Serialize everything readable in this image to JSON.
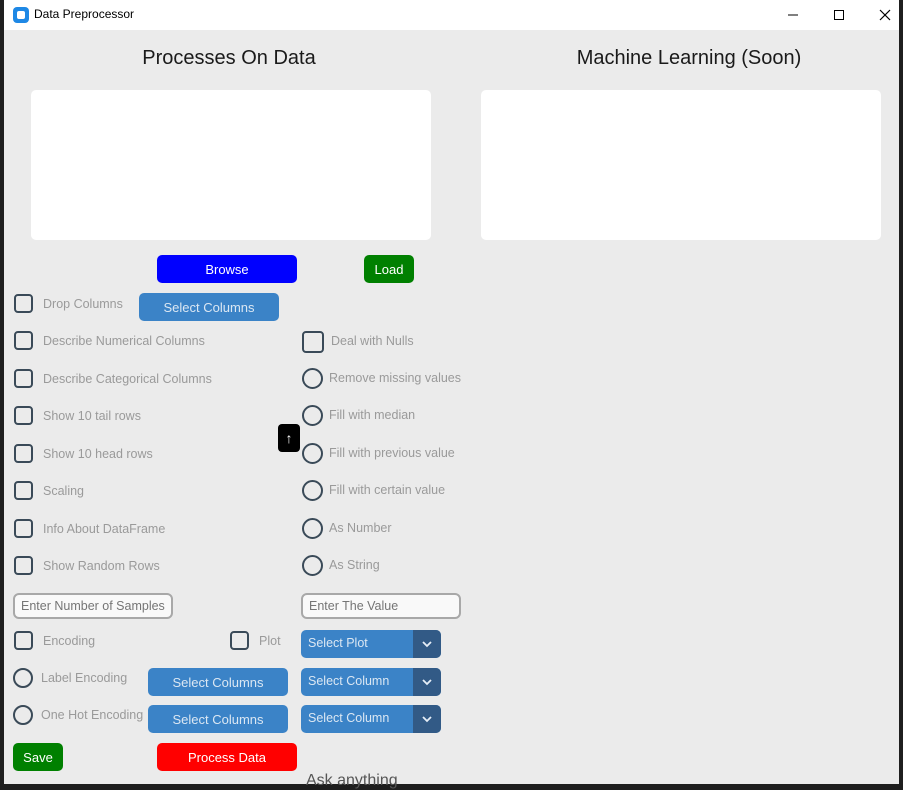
{
  "window": {
    "title": "Data Preprocessor"
  },
  "headings": {
    "left": "Processes On Data",
    "right": "Machine Learning (Soon)"
  },
  "buttons": {
    "browse": "Browse",
    "load": "Load",
    "select_columns_drop": "Select Columns",
    "select_columns_label": "Select Columns",
    "select_columns_onehot": "Select Columns",
    "save": "Save",
    "process": "Process Data"
  },
  "checkboxes": {
    "drop_columns": "Drop Columns",
    "describe_numerical": "Describe Numerical Columns",
    "describe_categorical": "Describe Categorical Columns",
    "tail_rows": "Show 10 tail rows",
    "head_rows": "Show 10 head rows",
    "scaling": "Scaling",
    "info": "Info About DataFrame",
    "random_rows": "Show Random Rows",
    "encoding": "Encoding",
    "plot": "Plot",
    "deal_nulls": "Deal with Nulls"
  },
  "radios": {
    "remove_missing": "Remove missing values",
    "fill_median": "Fill with median",
    "fill_previous": "Fill with previous value",
    "fill_certain": "Fill with certain value",
    "as_number": "As Number",
    "as_string": "As String",
    "label_encoding": "Label Encoding",
    "one_hot": "One Hot Encoding"
  },
  "inputs": {
    "samples_placeholder": "Enter Number of Samples",
    "value_placeholder": "Enter The Value"
  },
  "selects": {
    "plot": "Select Plot",
    "column1": "Select Column",
    "column2": "Select Column"
  },
  "scroll_up_glyph": "↑",
  "taskbar_text": "Ask anything",
  "colors": {
    "browse": "#0000ff",
    "load": "#008000",
    "save": "#008000",
    "process": "#ff0000",
    "steel": "#3b83c7",
    "select_arrow": "#325a86"
  }
}
